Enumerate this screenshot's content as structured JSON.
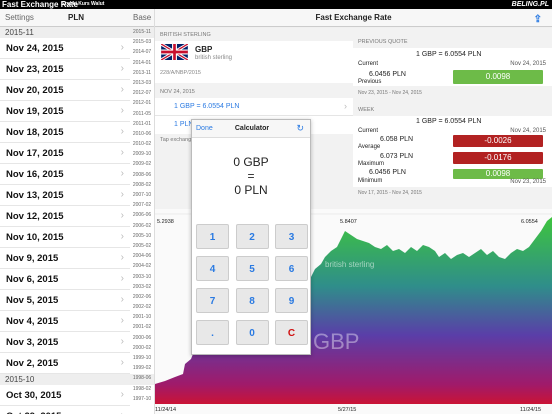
{
  "banner": {
    "title": "Fast Exchange Rate",
    "subtitle": "Szybki Kurs Walut",
    "brand": "BELING.PL"
  },
  "left": {
    "settings": "Settings",
    "currency": "PLN",
    "base": "Base",
    "sections": [
      {
        "label": "2015-11",
        "items": [
          "Nov 24, 2015",
          "Nov 23, 2015",
          "Nov 20, 2015",
          "Nov 19, 2015",
          "Nov 18, 2015",
          "Nov 17, 2015",
          "Nov 16, 2015",
          "Nov 13, 2015",
          "Nov 12, 2015",
          "Nov 10, 2015",
          "Nov 9, 2015",
          "Nov 6, 2015",
          "Nov 5, 2015",
          "Nov 4, 2015",
          "Nov 3, 2015",
          "Nov 2, 2015"
        ]
      },
      {
        "label": "2015-10",
        "items": [
          "Oct 30, 2015",
          "Oct 29, 2015"
        ]
      }
    ],
    "index": [
      "2015-11",
      "2015-03",
      "2014-07",
      "2014-01",
      "2013-11",
      "2013-03",
      "2012-07",
      "2012-01",
      "2011-05",
      "2011-01",
      "2010-06",
      "2010-02",
      "2009-10",
      "2009-02",
      "2008-06",
      "2008-02",
      "2007-10",
      "2007-02",
      "2006-06",
      "2006-02",
      "2005-10",
      "2005-02",
      "2004-06",
      "2004-02",
      "2003-10",
      "2003-02",
      "2002-06",
      "2002-02",
      "2001-10",
      "2001-02",
      "2000-06",
      "2000-02",
      "1999-10",
      "1999-02",
      "1998-06",
      "1998-02",
      "1997-10"
    ]
  },
  "main": {
    "title": "Fast Exchange Rate",
    "info": {
      "label": "BRITISH STERLING",
      "code": "GBP",
      "name": "british sterling",
      "table": "228/A/NBP/2015",
      "date": "NOV 24, 2015",
      "rate": "1 GBP = 6.0554 PLN",
      "row2": "1 PLN",
      "tap": "Tap exchang"
    },
    "prev": {
      "label": "PREVIOUS QUOTE",
      "rate": "1 GBP = 6.0554 PLN",
      "current": "Current",
      "current_date": "Nov 24, 2015",
      "value": "6.0456 PLN",
      "previous": "Previous",
      "change": "0.0098",
      "range": "Nov 23, 2015 - Nov 24, 2015"
    },
    "week": {
      "label": "WEEK",
      "rate": "1 GBP = 6.0554 PLN",
      "current": "Current",
      "current_date": "Nov 24, 2015",
      "avg_val": "6.058 PLN",
      "avg": "Average",
      "avg_change": "-0.0026",
      "max_val": "6.073 PLN",
      "max": "Maximum",
      "max_change": "-0.0176",
      "min_val": "6.0456 PLN",
      "min": "Minimum",
      "min_change": "0.0098",
      "min_date": "Nov 23, 2015",
      "range": "Nov 17, 2015 - Nov 24, 2015"
    },
    "month": {
      "label": "MONTH"
    },
    "chart": {
      "min": "5.2938",
      "mid": "5.8407",
      "max": "6.0554",
      "name": "british sterling",
      "code": "GBP",
      "x_start": "11/24/14",
      "x_mid": "5/27/15",
      "x_end": "11/24/15"
    }
  },
  "calc": {
    "done": "Done",
    "title": "Calculator",
    "line1": "0 GBP",
    "line2": "=",
    "line3": "0 PLN",
    "keys": [
      "1",
      "2",
      "3",
      "4",
      "5",
      "6",
      "7",
      "8",
      "9",
      ".",
      "0",
      "C"
    ]
  },
  "colors": {
    "accent": "#2a7ae2",
    "green": "#6dbb48",
    "red": "#b22222",
    "purple": "#5a3ea8"
  },
  "chart_data": {
    "type": "area",
    "x": [
      "11/24/14",
      "5/27/15",
      "11/24/15"
    ],
    "values_note_points": [
      5.2938,
      5.8407,
      6.0554
    ],
    "ylim": [
      5.2938,
      6.0554
    ]
  }
}
